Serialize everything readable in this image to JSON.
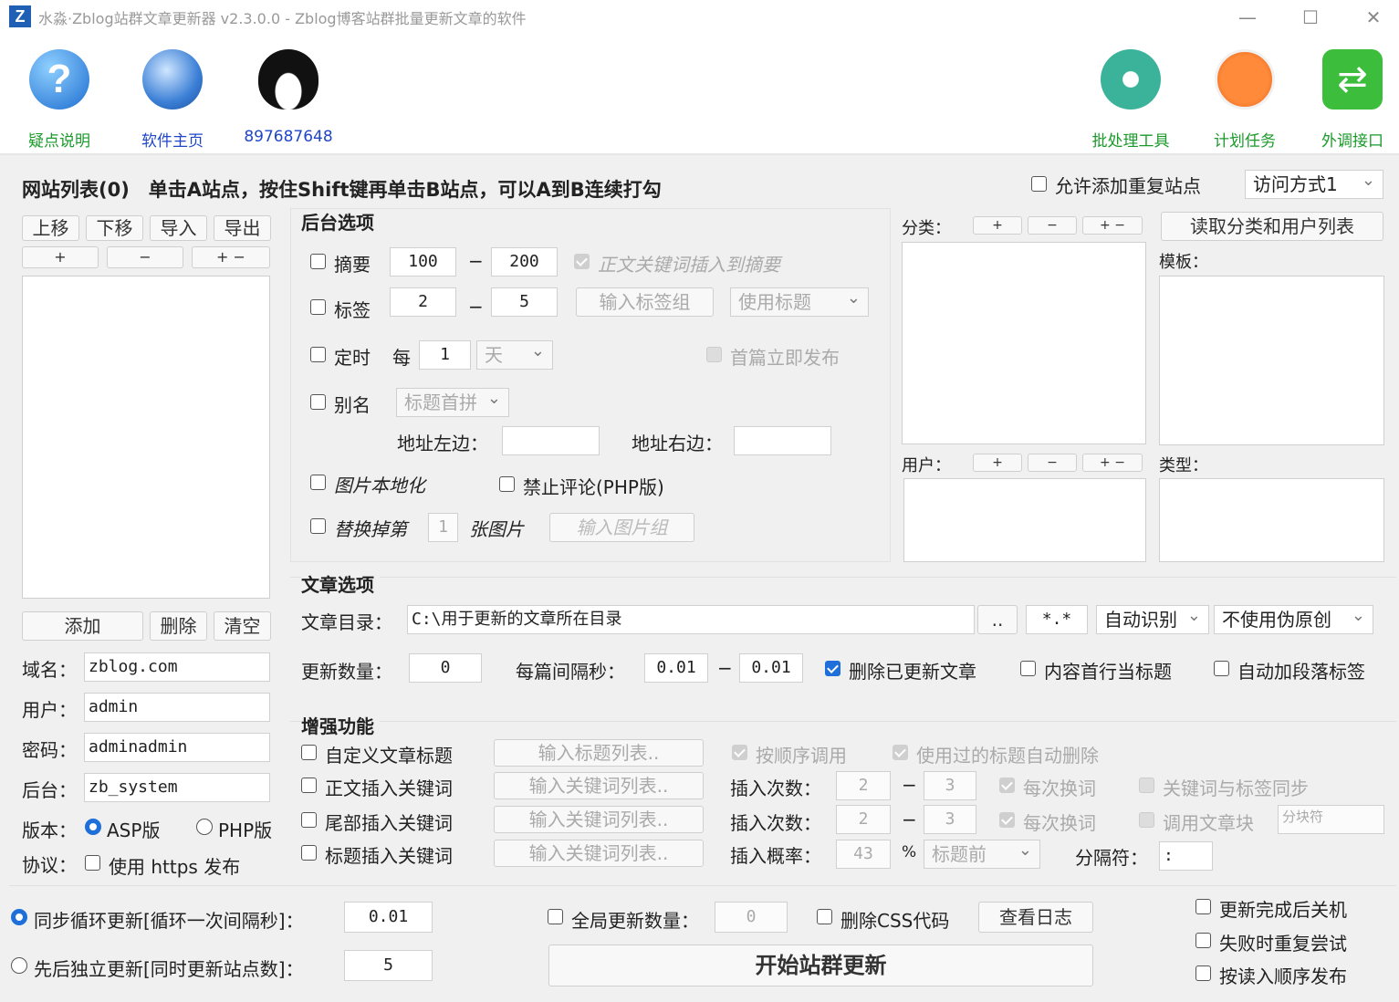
{
  "window": {
    "title": "水淼·Zblog站群文章更新器 v2.3.0.0 - Zblog博客站群批量更新文章的软件",
    "icon_letter": "Z",
    "min": "—",
    "max": "☐",
    "close": "✕"
  },
  "toolbar": {
    "help": "疑点说明",
    "home": "软件主页",
    "qq": "897687648",
    "batch": "批处理工具",
    "schedule": "计划任务",
    "api": "外调接口"
  },
  "sitelist": {
    "title": "网站列表(0)　单击A站点，按住Shift键再单击B站点，可以A到B连续打勾",
    "up": "上移",
    "down": "下移",
    "import": "导入",
    "export": "导出",
    "plus": "+",
    "minus": "−",
    "pm": "+ −",
    "add": "添加",
    "delete": "删除",
    "clear": "清空",
    "domain_label": "域名：",
    "domain": "zblog.com",
    "user_label": "用户：",
    "user": "admin",
    "pwd_label": "密码：",
    "pwd": "adminadmin",
    "backend_label": "后台：",
    "backend": "zb_system",
    "version_label": "版本：",
    "asp": "ASP版",
    "php": "PHP版",
    "protocol_label": "协议：",
    "https": "使用 https 发布"
  },
  "top_right": {
    "allow_dup": "允许添加重复站点",
    "access_mode": "访问方式1"
  },
  "backend": {
    "title": "后台选项",
    "summary": "摘要",
    "summary_min": "100",
    "summary_max": "200",
    "summary_kw": "正文关键词插入到摘要",
    "tags": "标签",
    "tags_min": "2",
    "tags_max": "5",
    "tag_group": "输入标签组",
    "tag_mode": "使用标题",
    "timer": "定时",
    "every": "每",
    "every_n": "1",
    "unit": "天",
    "first_publish": "首篇立即发布",
    "alias": "别名",
    "alias_mode": "标题首拼",
    "url_left": "地址左边：",
    "url_right": "地址右边：",
    "local_img": "图片本地化",
    "no_comment": "禁止评论(PHP版)",
    "replace": "替换掉第",
    "replace_n": "1",
    "pics": "张图片",
    "pic_group": "输入图片组",
    "dash": "−"
  },
  "category": {
    "cat_label": "分类：",
    "fetch": "读取分类和用户列表",
    "tpl_label": "模板：",
    "user_label": "用户：",
    "type_label": "类型：",
    "plus": "+",
    "minus": "−",
    "pm": "+ −"
  },
  "article": {
    "title": "文章选项",
    "dir_label": "文章目录：",
    "dir": "C:\\用于更新的文章所在目录",
    "browse": "..",
    "ext": "*.*",
    "encoding": "自动识别",
    "pseudo": "不使用伪原创",
    "count_label": "更新数量：",
    "count": "0",
    "interval_label": "每篇间隔秒：",
    "interval_min": "0.01",
    "interval_max": "0.01",
    "dash": "−",
    "delete_updated": "删除已更新文章",
    "first_line_title": "内容首行当标题",
    "auto_p": "自动加段落标签"
  },
  "enhance": {
    "title": "增强功能",
    "custom_title": "自定义文章标题",
    "title_list": "输入标题列表..",
    "in_order": "按顺序调用",
    "auto_delete": "使用过的标题自动删除",
    "body_kw": "正文插入关键词",
    "kw_list": "输入关键词列表..",
    "insert_count": "插入次数：",
    "c1_min": "2",
    "c1_max": "3",
    "each_change": "每次换词",
    "kw_tag_sync": "关键词与标签同步",
    "tail_kw": "尾部插入关键词",
    "c2_min": "2",
    "c2_max": "3",
    "call_block": "调用文章块",
    "block_sep": "分块符",
    "title_kw": "标题插入关键词",
    "insert_prob": "插入概率：",
    "prob": "43",
    "percent": "%",
    "position": "标题前",
    "sep_label": "分隔符：",
    "sep": ":",
    "dash": "−"
  },
  "bottom": {
    "sync_loop": "同步循环更新[循环一次间隔秒]：",
    "sync_val": "0.01",
    "indep": "先后独立更新[同时更新站点数]：",
    "indep_val": "5",
    "global_count": "全局更新数量：",
    "global_val": "0",
    "del_css": "删除CSS代码",
    "view_log": "查看日志",
    "start": "开始站群更新",
    "shutdown": "更新完成后关机",
    "retry": "失败时重复尝试",
    "order": "按读入顺序发布"
  }
}
